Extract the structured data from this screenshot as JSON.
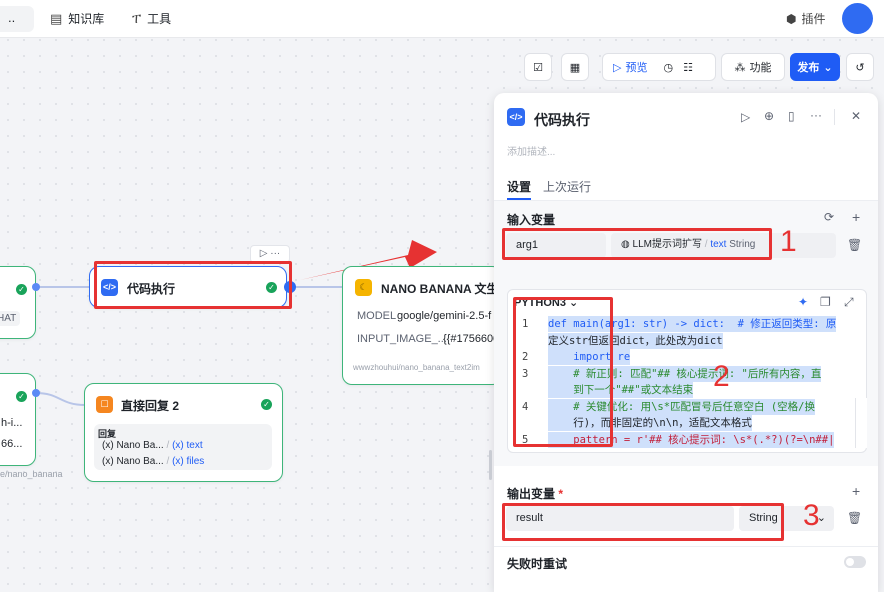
{
  "nav": {
    "back_label": "..",
    "knowledge_label": "知识库",
    "tools_label": "工具",
    "plugin_label": "插件"
  },
  "toolbar": {
    "preview_label": "预览",
    "features_label": "功能",
    "publish_label": "发布"
  },
  "nodes": {
    "left_top": {
      "tag": "HAT"
    },
    "left_bottom": {
      "line1": "h-i...",
      "line2": "66...",
      "path": "e/nano_banana"
    },
    "code_exec": {
      "title": "代码执行"
    },
    "nano": {
      "title": "NANO BANANA 文生",
      "model_label": "MODEL",
      "model_value": "google/gemini-2.5-f",
      "input_label": "INPUT_IMAGE_...",
      "input_value": "{{#1756600",
      "footer": "wwwzhouhui/nano_banana_text2im"
    },
    "reply": {
      "title": "直接回复 2",
      "section_label": "回复",
      "item1_name": "Nano Ba...",
      "item1_var": "text",
      "item2_name": "Nano Ba...",
      "item2_var": "files"
    }
  },
  "panel": {
    "title": "代码执行",
    "description_placeholder": "添加描述...",
    "tabs": [
      "设置",
      "上次运行"
    ],
    "input_section": {
      "title": "输入变量",
      "var_name": "arg1",
      "source_node": "LLM提示词扩写",
      "source_var": "text",
      "source_type": "String"
    },
    "code": {
      "language": "PYTHON3",
      "lines": [
        {
          "num": "1",
          "text": "def main(arg1: str) -> dict:  # 修正返回类型: 原"
        },
        {
          "num": "",
          "text": "定义str但返回dict，此处改为dict"
        },
        {
          "num": "2",
          "text": "    import re"
        },
        {
          "num": "3",
          "text": "    # 新正则: 匹配\"## 核心提示词: \"后所有内容，直"
        },
        {
          "num": "",
          "text": "    到下一个\"##\"或文本结束"
        },
        {
          "num": "4",
          "text": "    # 关键优化: 用\\s*匹配冒号后任意空白 (空格/换"
        },
        {
          "num": "",
          "text": "    行)，而非固定的\\n\\n，适配文本格式"
        },
        {
          "num": "5",
          "text": "    pattern = r'## 核心提示词: \\s*(.*?)(?=\\n##|"
        }
      ]
    },
    "output_section": {
      "title": "输出变量",
      "required_mark": "*",
      "var_name": "result",
      "var_type": "String"
    },
    "retry_label": "失败时重试"
  },
  "annotations": {
    "box1_number": "1",
    "box2_number": "2",
    "box3_number": "3"
  },
  "colors": {
    "accent": "#1f5cf5",
    "annotation_red": "#e63232",
    "success_green": "#19a35a"
  }
}
